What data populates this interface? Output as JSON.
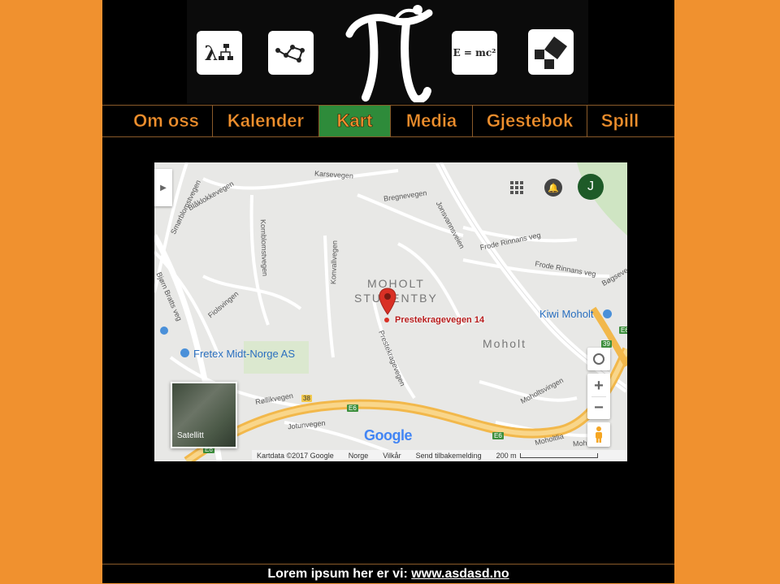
{
  "nav": {
    "items": [
      {
        "label": "Om oss",
        "active": false
      },
      {
        "label": "Kalender",
        "active": false
      },
      {
        "label": "Kart",
        "active": true
      },
      {
        "label": "Media",
        "active": false
      },
      {
        "label": "Gjestebok",
        "active": false
      },
      {
        "label": "Spill",
        "active": false
      }
    ]
  },
  "banner": {
    "icons": [
      "lambda-flowchart-icon",
      "graph-network-icon",
      "pi-figure-logo",
      "emc2-icon",
      "pythagoras-icon"
    ],
    "emc2_text": "E = mc²",
    "lambda_text": "λ"
  },
  "map": {
    "marker_label": "Prestekragevegen 14",
    "area_labels": [
      "MOHOLT",
      "STUDENTBY",
      "Moholt"
    ],
    "poi": [
      "Kiwi Moholt",
      "Fretex Midt-Norge AS"
    ],
    "roads": [
      "Karsevegen",
      "Bregnevegen",
      "Jonsvannsveien",
      "Frode Rinnans veg",
      "Frode Rinnans veg",
      "Bøgsevegen",
      "Kornblomstvegen",
      "Konvallvegen",
      "Fiolsvingen",
      "Prestekragevegen",
      "Røllikvegen",
      "Jotunvegen",
      "Moholtsvingen",
      "Moholtlia",
      "Bjørn Bratts veg",
      "Smørblomstvegen",
      "Blåklokkevegen",
      "Moholt Allé"
    ],
    "road_shields": [
      "39",
      "38",
      "E6",
      "E6",
      "E6",
      "E6"
    ],
    "account_initial": "J",
    "satellite_label": "Satellitt",
    "google_logo": "Google",
    "zoom_in": "+",
    "zoom_out": "−",
    "footer": {
      "attribution": "Kartdata ©2017 Google",
      "region": "Norge",
      "terms": "Vilkår",
      "feedback": "Send tilbakemelding",
      "scale": "200 m"
    }
  },
  "footer": {
    "text": "Lorem ipsum her er vi: ",
    "link": "www.asdasd.no"
  },
  "colors": {
    "page_bg": "#f0912f",
    "content_bg": "#000000",
    "nav_text": "#f0912f",
    "nav_active_bg": "#2e8b3a",
    "marker": "#d93025"
  }
}
